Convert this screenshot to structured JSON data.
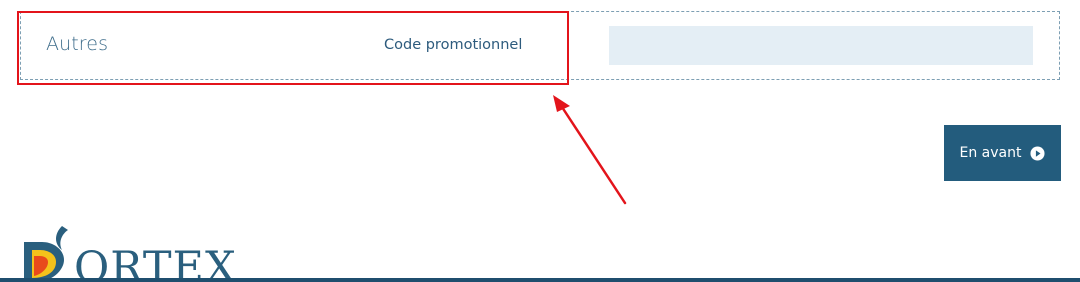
{
  "section": {
    "title": "Autres",
    "promo_label": "Code promotionnel",
    "promo_value": "",
    "promo_placeholder": ""
  },
  "actions": {
    "next_label": "En avant",
    "next_icon": "play-circle-icon"
  },
  "brand": {
    "logo_text": "DORTEX",
    "logo_icon": "flame-logo-icon"
  },
  "colors": {
    "accent": "#235c7d",
    "highlight": "#e3141b",
    "input_bg": "#e4eef5",
    "text": "#2d5b7d"
  }
}
